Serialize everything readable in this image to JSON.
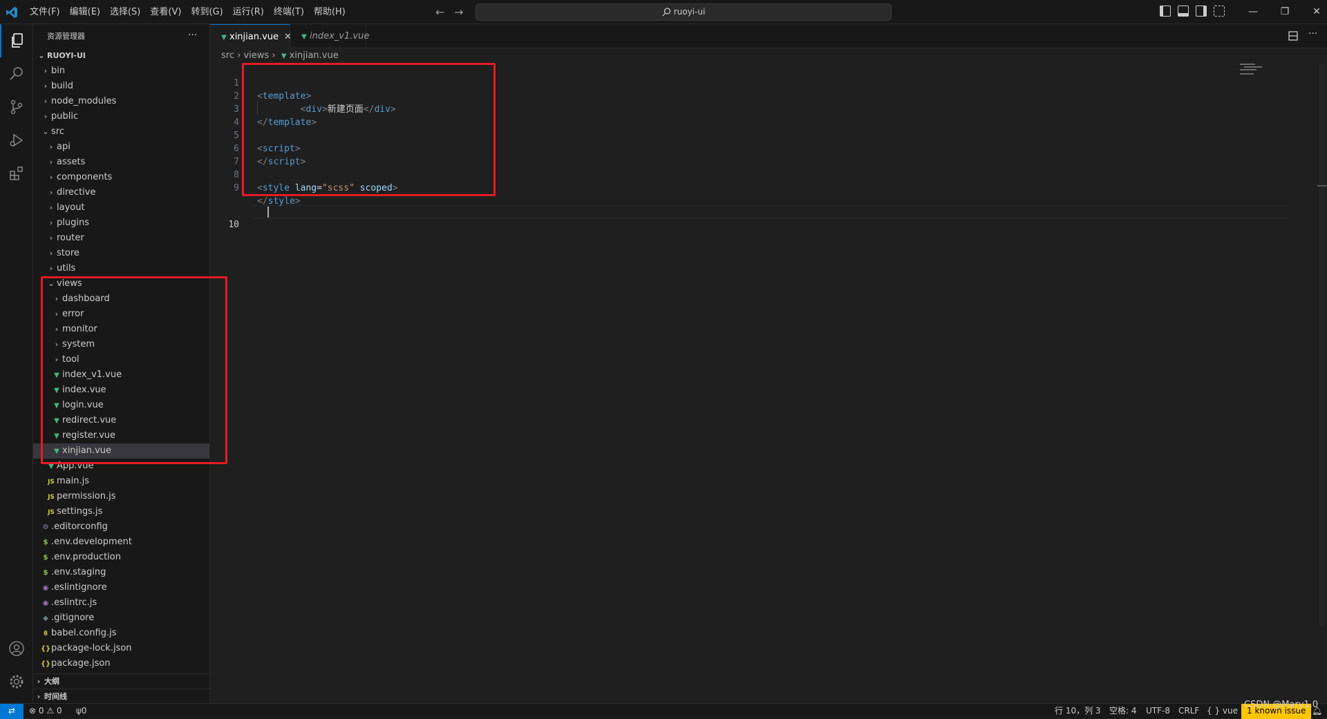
{
  "titlebar": {
    "menu": [
      "文件(F)",
      "编辑(E)",
      "选择(S)",
      "查看(V)",
      "转到(G)",
      "运行(R)",
      "终端(T)",
      "帮助(H)"
    ],
    "search_text": "ruoyi-ui",
    "nav_back": "←",
    "nav_forward": "→",
    "window_min": "—",
    "window_restore": "❐",
    "window_close": "✕"
  },
  "sidebar": {
    "title": "资源管理器",
    "more": "···",
    "root": "RUOYI-UI",
    "tree": [
      {
        "label": "bin",
        "type": "folder",
        "expanded": false,
        "depth": 1
      },
      {
        "label": "build",
        "type": "folder",
        "expanded": false,
        "depth": 1
      },
      {
        "label": "node_modules",
        "type": "folder",
        "expanded": false,
        "depth": 1
      },
      {
        "label": "public",
        "type": "folder",
        "expanded": false,
        "depth": 1
      },
      {
        "label": "src",
        "type": "folder",
        "expanded": true,
        "depth": 1
      },
      {
        "label": "api",
        "type": "folder",
        "expanded": false,
        "depth": 2
      },
      {
        "label": "assets",
        "type": "folder",
        "expanded": false,
        "depth": 2
      },
      {
        "label": "components",
        "type": "folder",
        "expanded": false,
        "depth": 2
      },
      {
        "label": "directive",
        "type": "folder",
        "expanded": false,
        "depth": 2
      },
      {
        "label": "layout",
        "type": "folder",
        "expanded": false,
        "depth": 2
      },
      {
        "label": "plugins",
        "type": "folder",
        "expanded": false,
        "depth": 2
      },
      {
        "label": "router",
        "type": "folder",
        "expanded": false,
        "depth": 2
      },
      {
        "label": "store",
        "type": "folder",
        "expanded": false,
        "depth": 2
      },
      {
        "label": "utils",
        "type": "folder",
        "expanded": false,
        "depth": 2
      },
      {
        "label": "views",
        "type": "folder",
        "expanded": true,
        "depth": 2
      },
      {
        "label": "dashboard",
        "type": "folder",
        "expanded": false,
        "depth": 3
      },
      {
        "label": "error",
        "type": "folder",
        "expanded": false,
        "depth": 3
      },
      {
        "label": "monitor",
        "type": "folder",
        "expanded": false,
        "depth": 3
      },
      {
        "label": "system",
        "type": "folder",
        "expanded": false,
        "depth": 3
      },
      {
        "label": "tool",
        "type": "folder",
        "expanded": false,
        "depth": 3
      },
      {
        "label": "index_v1.vue",
        "type": "vue",
        "depth": 3
      },
      {
        "label": "index.vue",
        "type": "vue",
        "depth": 3
      },
      {
        "label": "login.vue",
        "type": "vue",
        "depth": 3
      },
      {
        "label": "redirect.vue",
        "type": "vue",
        "depth": 3
      },
      {
        "label": "register.vue",
        "type": "vue",
        "depth": 3
      },
      {
        "label": "xinjian.vue",
        "type": "vue",
        "depth": 3,
        "selected": true
      },
      {
        "label": "App.vue",
        "type": "vue",
        "depth": 2
      },
      {
        "label": "main.js",
        "type": "js",
        "depth": 2
      },
      {
        "label": "permission.js",
        "type": "js",
        "depth": 2
      },
      {
        "label": "settings.js",
        "type": "js",
        "depth": 2
      },
      {
        "label": ".editorconfig",
        "type": "gear",
        "depth": 1
      },
      {
        "label": ".env.development",
        "type": "env",
        "depth": 1
      },
      {
        "label": ".env.production",
        "type": "env",
        "depth": 1
      },
      {
        "label": ".env.staging",
        "type": "env",
        "depth": 1
      },
      {
        "label": ".eslintignore",
        "type": "lint",
        "depth": 1
      },
      {
        "label": ".eslintrc.js",
        "type": "lint",
        "depth": 1
      },
      {
        "label": ".gitignore",
        "type": "ign",
        "depth": 1
      },
      {
        "label": "babel.config.js",
        "type": "babel",
        "depth": 1
      },
      {
        "label": "package-lock.json",
        "type": "json",
        "depth": 1
      },
      {
        "label": "package.json",
        "type": "json",
        "depth": 1
      }
    ],
    "outline_label": "大纲",
    "timeline_label": "时间线"
  },
  "tabs": [
    {
      "label": "xinjian.vue",
      "active": true
    },
    {
      "label": "index_v1.vue",
      "active": false
    }
  ],
  "breadcrumb": {
    "seg1": "src",
    "seg2": "views",
    "seg3": "xinjian.vue"
  },
  "code": {
    "line_numbers": [
      "1",
      "2",
      "3",
      "4",
      "5",
      "6",
      "7",
      "8",
      "9",
      "10"
    ],
    "l1_open": "<",
    "l1_tag": "template",
    "l1_close": ">",
    "l2_indent": "        ",
    "l2_open": "<",
    "l2_tag": "div",
    "l2_close": ">",
    "l2_text": "新建页面",
    "l2_end_open": "</",
    "l2_end_tag": "div",
    "l2_end_close": ">",
    "l3_open": "</",
    "l3_tag": "template",
    "l3_close": ">",
    "l5_open": "<",
    "l5_tag": "script",
    "l5_close": ">",
    "l6_open": "</",
    "l6_tag": "script",
    "l6_close": ">",
    "l8_open": "<",
    "l8_tag": "style",
    "l8_attr1": " lang",
    "l8_eq": "=",
    "l8_val": "\"scss\"",
    "l8_attr2": " scoped",
    "l8_close": ">",
    "l9_open": "</",
    "l9_tag": "style",
    "l9_close": ">"
  },
  "statusbar": {
    "errors": "0",
    "warnings": "0",
    "ports": "0",
    "position": "行 10，列 3",
    "spaces": "空格: 4",
    "encoding": "UTF-8",
    "eol": "CRLF",
    "language": "vue",
    "known_issue": "1 known issue"
  },
  "watermark": "CSDN @Mary1.0",
  "colors": {
    "accent": "#0078d4",
    "highlight_box": "#e51c23",
    "vue_icon": "#41b883",
    "issue_badge": "#ffc600"
  }
}
